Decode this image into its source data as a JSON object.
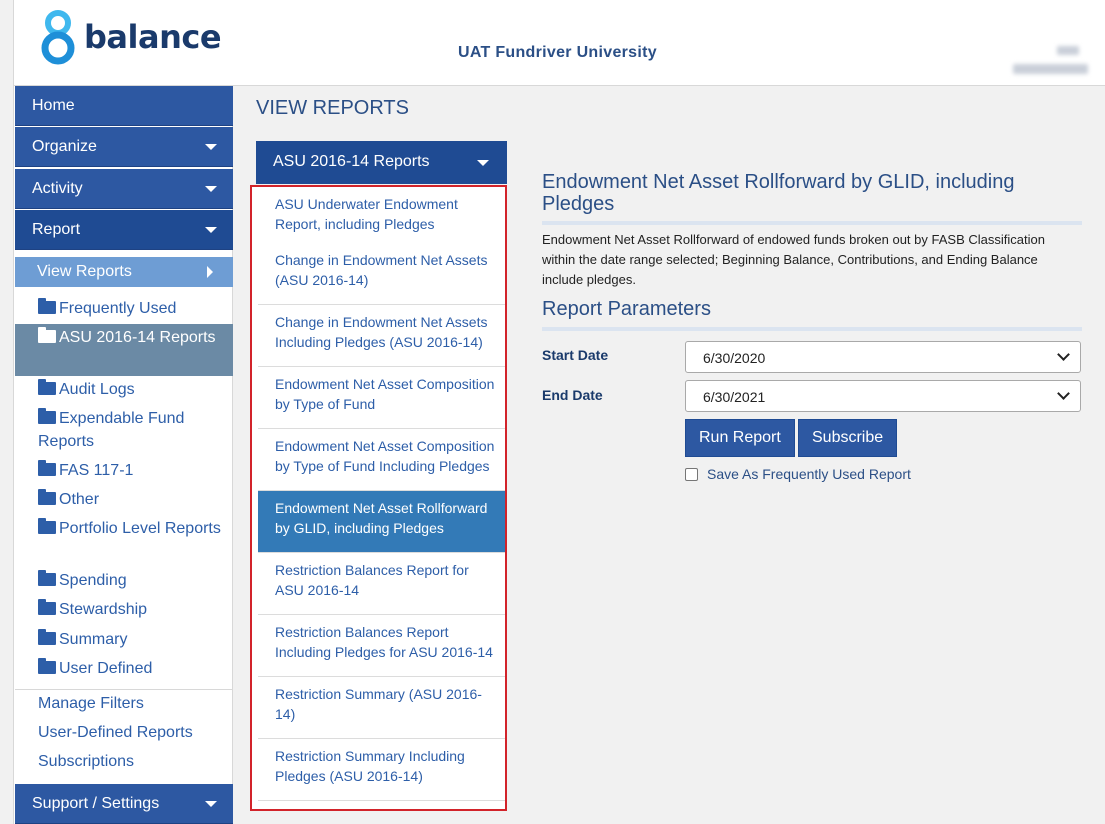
{
  "header": {
    "brand": "balance",
    "organization": "UAT Fundriver University"
  },
  "nav": {
    "home": "Home",
    "organize": "Organize",
    "activity": "Activity",
    "report": "Report",
    "view_reports": "View Reports",
    "folders": [
      "Frequently Used",
      "ASU 2016-14 Reports",
      "Audit Logs",
      "Expendable Fund Reports",
      "FAS 117-1",
      "Other",
      "Portfolio Level Reports",
      "Spending",
      "Stewardship",
      "Summary",
      "User Defined"
    ],
    "links": [
      "Manage Filters",
      "User-Defined Reports",
      "Subscriptions"
    ],
    "support": "Support / Settings"
  },
  "main": {
    "title": "VIEW REPORTS",
    "category": "ASU 2016-14 Reports",
    "reports": [
      "ASU Underwater Endowment Report, including Pledges",
      "Change in Endowment Net Assets (ASU 2016-14)",
      "Change in Endowment Net Assets Including Pledges (ASU 2016-14)",
      "Endowment Net Asset Composition by Type of Fund",
      "Endowment Net Asset Composition by Type of Fund Including Pledges",
      "Endowment Net Asset Rollforward by GLID, including Pledges",
      "Restriction Balances Report for ASU 2016-14",
      "Restriction Balances Report Including Pledges for ASU 2016-14",
      "Restriction Summary (ASU 2016-14)",
      "Restriction Summary Including Pledges (ASU 2016-14)"
    ]
  },
  "detail": {
    "title": "Endowment Net Asset Rollforward by GLID, including Pledges",
    "description": "Endowment Net Asset Rollforward of endowed funds broken out by FASB Classification within the date range selected; Beginning Balance, Contributions, and Ending Balance include pledges.",
    "params_heading": "Report Parameters",
    "start_label": "Start Date",
    "start_value": "6/30/2020",
    "end_label": "End Date",
    "end_value": "6/30/2021",
    "run_label": "Run Report",
    "subscribe_label": "Subscribe",
    "save_label": "Save As Frequently Used Report"
  },
  "colors": {
    "nav_blue": "#2d58a2",
    "nav_active": "#1f4b93",
    "selected_report": "#337ab7",
    "highlight_border": "#d2232a"
  }
}
